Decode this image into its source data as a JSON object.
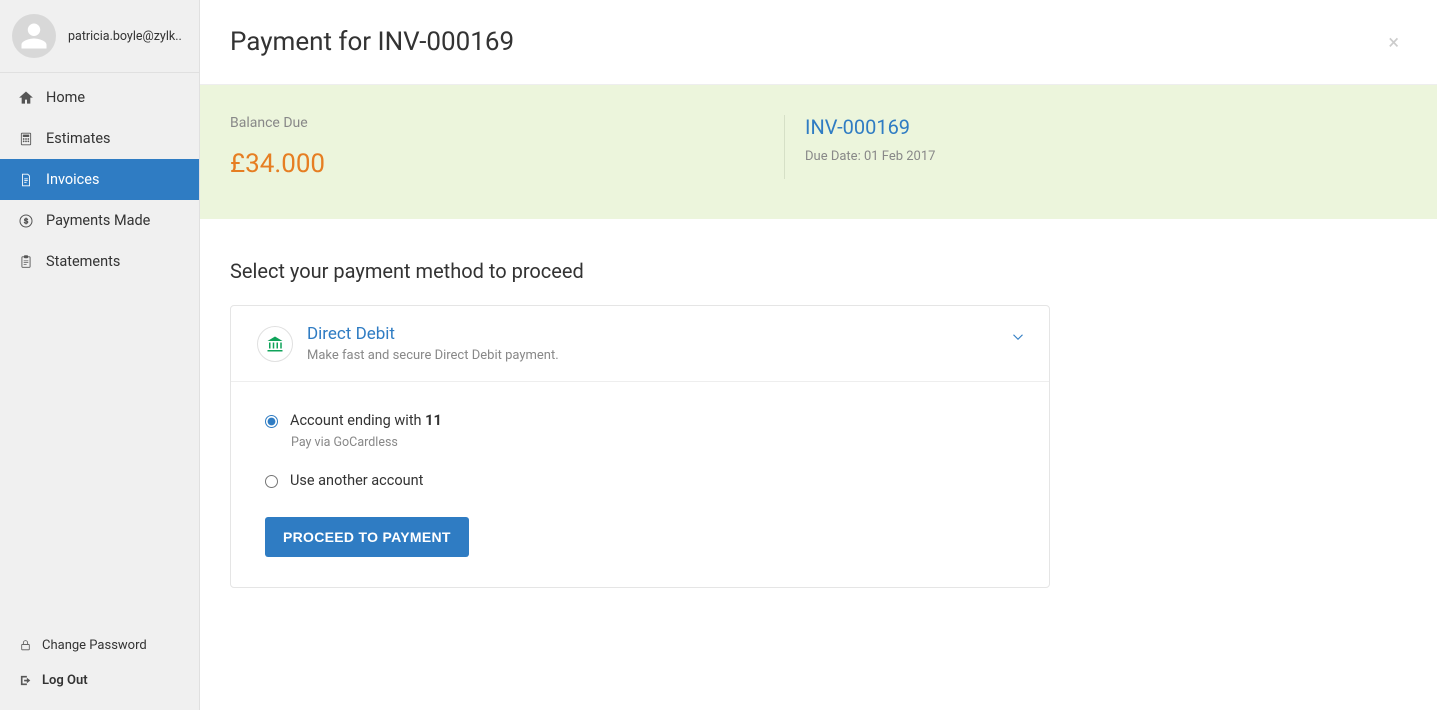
{
  "user": {
    "email": "patricia.boyle@zylk.."
  },
  "sidebar": {
    "items": [
      {
        "label": "Home"
      },
      {
        "label": "Estimates"
      },
      {
        "label": "Invoices"
      },
      {
        "label": "Payments Made"
      },
      {
        "label": "Statements"
      }
    ],
    "footer": {
      "change_password": "Change Password",
      "log_out": "Log Out"
    }
  },
  "header": {
    "title": "Payment for INV-000169",
    "close": "×"
  },
  "summary": {
    "balance_label": "Balance Due",
    "balance_amount": "£34.000",
    "invoice_number": "INV-000169",
    "due_date": "Due Date: 01 Feb 2017"
  },
  "section_title": "Select your payment method to proceed",
  "method": {
    "title": "Direct Debit",
    "desc": "Make fast and secure Direct Debit payment."
  },
  "options": {
    "account_prefix": "Account ending with ",
    "account_suffix": "11",
    "account_sub": "Pay via GoCardless",
    "other_label": "Use another account"
  },
  "proceed_label": "PROCEED TO PAYMENT"
}
